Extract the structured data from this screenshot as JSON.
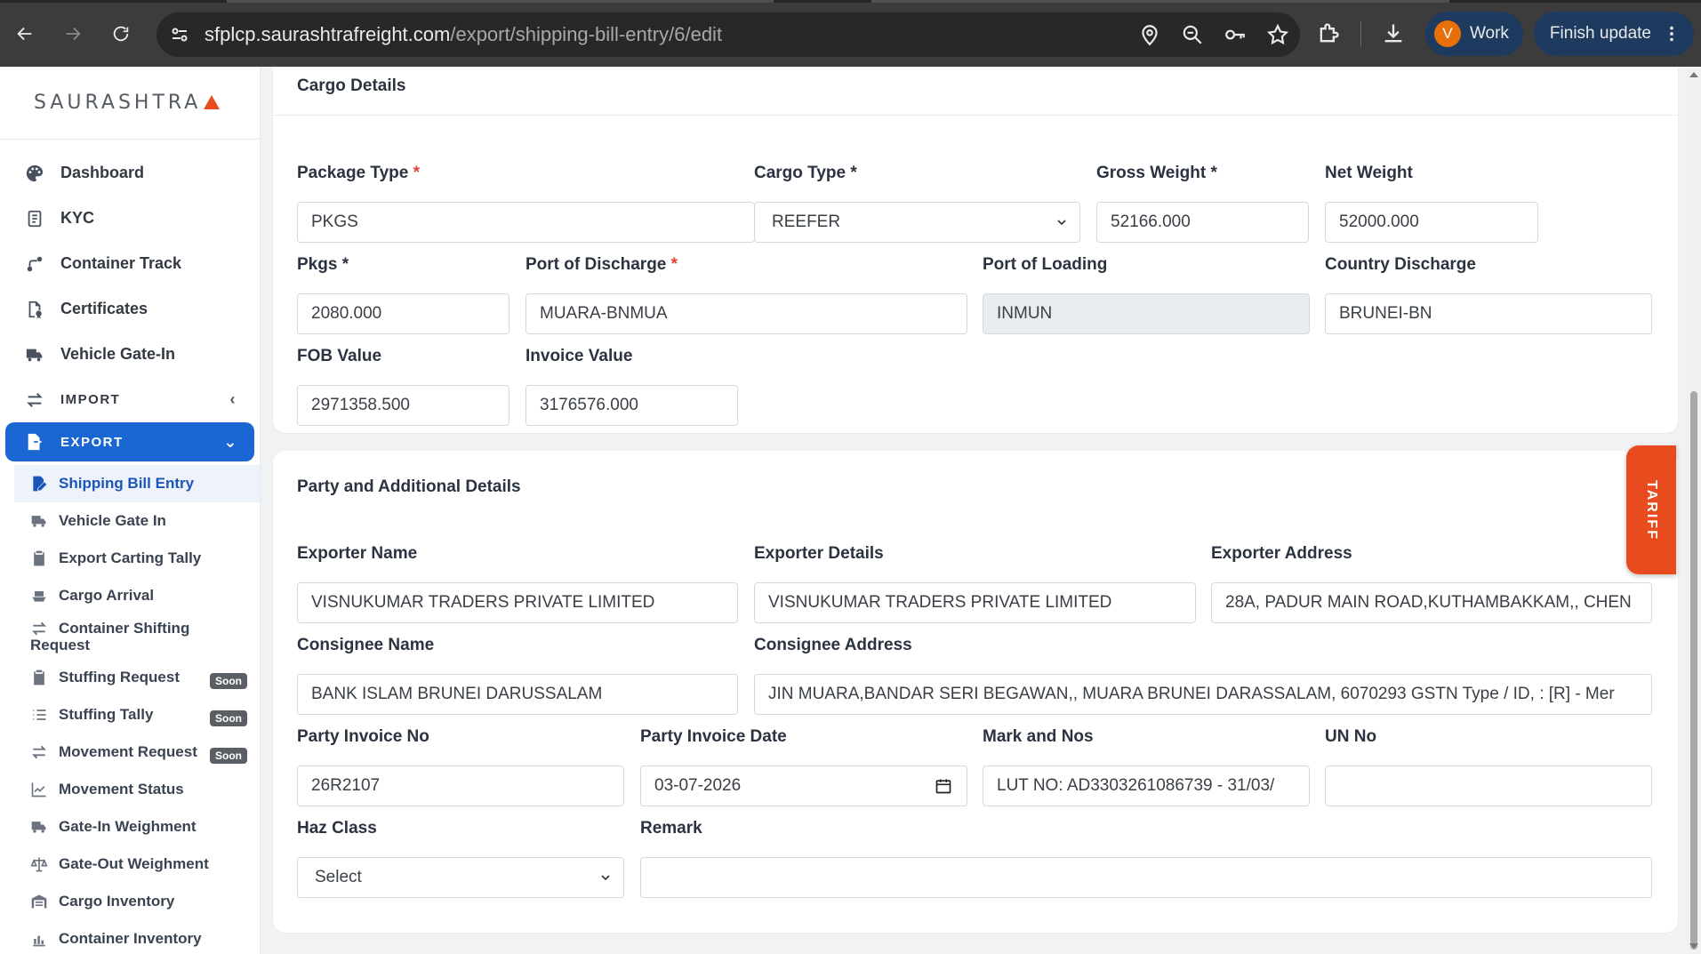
{
  "browser": {
    "url_host": "sfplcp.saurashtrafreight.com",
    "url_path": "/export/shipping-bill-entry/6/edit",
    "profile_initial": "V",
    "profile_label": "Work",
    "update_label": "Finish update"
  },
  "sidebar": {
    "brand": "SAURASHTRA",
    "items": [
      {
        "label": "Dashboard",
        "icon": "palette-icon"
      },
      {
        "label": "KYC",
        "icon": "id-card-icon"
      },
      {
        "label": "Container Track",
        "icon": "route-icon"
      },
      {
        "label": "Certificates",
        "icon": "file-certificate-icon"
      },
      {
        "label": "Vehicle Gate-In",
        "icon": "truck-icon"
      },
      {
        "label": "IMPORT",
        "icon": "arrows-exchange-icon"
      },
      {
        "label": "EXPORT",
        "icon": "file-export-icon"
      }
    ],
    "export_sub": [
      {
        "label": "Shipping Bill Entry"
      },
      {
        "label": "Vehicle Gate In"
      },
      {
        "label": "Export Carting Tally"
      },
      {
        "label": "Cargo Arrival"
      },
      {
        "label": "Container Shifting",
        "label2": "Request"
      },
      {
        "label": "Stuffing Request",
        "badge": "Soon"
      },
      {
        "label": "Stuffing Tally",
        "badge": "Soon"
      },
      {
        "label": "Movement Request",
        "badge": "Soon"
      },
      {
        "label": "Movement Status"
      },
      {
        "label": "Gate-In Weighment"
      },
      {
        "label": "Gate-Out Weighment"
      },
      {
        "label": "Cargo Inventory"
      },
      {
        "label": "Container Inventory"
      }
    ]
  },
  "cargo": {
    "title": "Cargo Details",
    "package_type": {
      "label": "Package Type",
      "req": "*",
      "value": "PKGS"
    },
    "cargo_type": {
      "label": "Cargo Type *",
      "value": "REEFER"
    },
    "gross_weight": {
      "label": "Gross Weight *",
      "value": "52166.000"
    },
    "net_weight": {
      "label": "Net Weight",
      "value": "52000.000"
    },
    "pkgs": {
      "label": "Pkgs *",
      "value": "2080.000"
    },
    "port_discharge": {
      "label": "Port of Discharge",
      "req": "*",
      "value": "MUARA-BNMUA"
    },
    "port_loading": {
      "label": "Port of Loading",
      "value": "INMUN"
    },
    "country_discharge": {
      "label": "Country Discharge",
      "value": "BRUNEI-BN"
    },
    "fob_value": {
      "label": "FOB Value",
      "value": "2971358.500"
    },
    "invoice_value": {
      "label": "Invoice Value",
      "value": "3176576.000"
    }
  },
  "party": {
    "title": "Party and Additional Details",
    "exporter_name": {
      "label": "Exporter Name",
      "value": "VISNUKUMAR TRADERS PRIVATE LIMITED"
    },
    "exporter_details": {
      "label": "Exporter Details",
      "value": "VISNUKUMAR TRADERS PRIVATE LIMITED"
    },
    "exporter_address": {
      "label": "Exporter Address",
      "value": "28A, PADUR MAIN ROAD,KUTHAMBAKKAM,, CHEN"
    },
    "consignee_name": {
      "label": "Consignee Name",
      "value": "BANK ISLAM BRUNEI DARUSSALAM"
    },
    "consignee_address": {
      "label": "Consignee Address",
      "value": "JIN MUARA,BANDAR SERI BEGAWAN,, MUARA BRUNEI DARASSALAM, 6070293 GSTN Type / ID, : [R] - Mer"
    },
    "party_invoice_no": {
      "label": "Party Invoice No",
      "value": "26R2107"
    },
    "party_invoice_date": {
      "label": "Party Invoice Date",
      "value": "03-07-2026"
    },
    "mark_nos": {
      "label": "Mark and Nos",
      "value": "LUT NO: AD3303261086739 - 31/03/"
    },
    "un_no": {
      "label": "UN No",
      "value": ""
    },
    "haz_class": {
      "label": "Haz Class",
      "value": "Select"
    },
    "remark": {
      "label": "Remark",
      "value": ""
    }
  },
  "tariff_label": "TARIFF"
}
